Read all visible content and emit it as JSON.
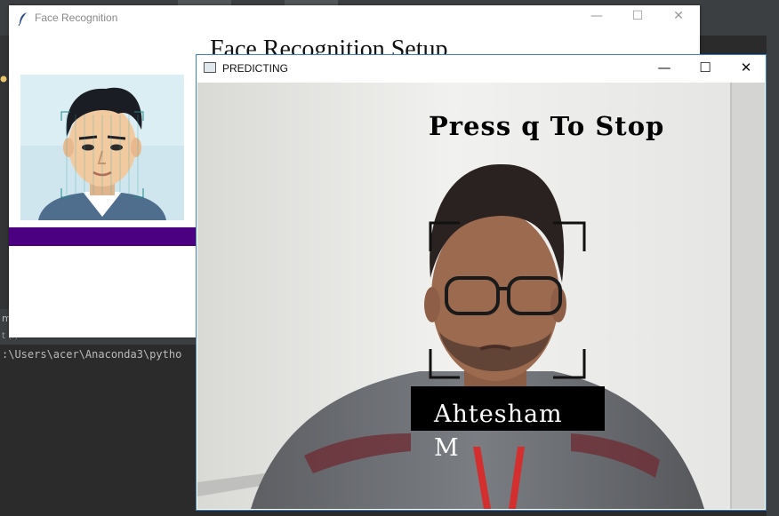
{
  "ide": {
    "console_text": ":\\Users\\acer\\Anaconda3\\pytho",
    "panel_tab_label": "mg",
    "panel_tab2_label": "t (f)"
  },
  "face_window": {
    "title": "Face Recognition",
    "heading": "Face Recognition Setup",
    "min_glyph": "—",
    "max_glyph": "☐",
    "close_glyph": "✕",
    "accent_color": "#4b0082"
  },
  "predict_window": {
    "title": "PREDICTING",
    "overlay_text": "Press q To Stop",
    "name_label": "Ahtesham M",
    "min_glyph": "—",
    "max_glyph": "☐",
    "close_glyph": "✕"
  }
}
